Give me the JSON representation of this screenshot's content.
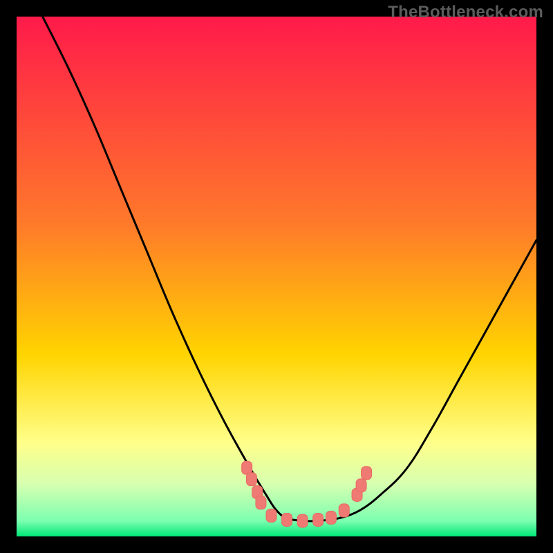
{
  "watermark": "TheBottleneck.com",
  "colors": {
    "frame": "#000000",
    "watermark": "#5b5b5b",
    "gradient_top": "#ff1a4a",
    "gradient_mid": "#ffd400",
    "gradient_green": "#00e676",
    "curve_stroke": "#000000",
    "marker_fill": "#ef7a74",
    "marker_stroke": "#e86a62"
  },
  "chart_data": {
    "type": "line",
    "title": "",
    "xlabel": "",
    "ylabel": "",
    "xlim": [
      0,
      100
    ],
    "ylim": [
      0,
      100
    ],
    "grid": false,
    "legend": false,
    "gradient_stops": [
      {
        "offset": 0.0,
        "color": "#ff1a4a"
      },
      {
        "offset": 0.4,
        "color": "#ff7a2a"
      },
      {
        "offset": 0.65,
        "color": "#ffd400"
      },
      {
        "offset": 0.82,
        "color": "#ffff8a"
      },
      {
        "offset": 0.9,
        "color": "#d6ffb0"
      },
      {
        "offset": 0.97,
        "color": "#7dffb0"
      },
      {
        "offset": 1.0,
        "color": "#00e676"
      }
    ],
    "series": [
      {
        "name": "bottleneck-curve",
        "x": [
          5,
          10,
          15,
          20,
          25,
          30,
          35,
          40,
          45,
          48,
          50,
          52,
          55,
          58,
          62,
          66,
          70,
          75,
          80,
          85,
          90,
          95,
          100
        ],
        "y": [
          100,
          90,
          79,
          67,
          55,
          43,
          32,
          22,
          13,
          8,
          5,
          3.5,
          3,
          3,
          3.5,
          5,
          8,
          13,
          21,
          30,
          39,
          48,
          57
        ]
      }
    ],
    "markers": [
      {
        "x": 44.3,
        "y": 13.2
      },
      {
        "x": 45.2,
        "y": 11.0
      },
      {
        "x": 46.3,
        "y": 8.5
      },
      {
        "x": 47.0,
        "y": 6.5
      },
      {
        "x": 49.0,
        "y": 4.0
      },
      {
        "x": 52.0,
        "y": 3.2
      },
      {
        "x": 55.0,
        "y": 3.0
      },
      {
        "x": 58.0,
        "y": 3.2
      },
      {
        "x": 60.5,
        "y": 3.6
      },
      {
        "x": 63.0,
        "y": 5.0
      },
      {
        "x": 65.5,
        "y": 8.0
      },
      {
        "x": 66.3,
        "y": 9.8
      },
      {
        "x": 67.3,
        "y": 12.2
      }
    ]
  }
}
